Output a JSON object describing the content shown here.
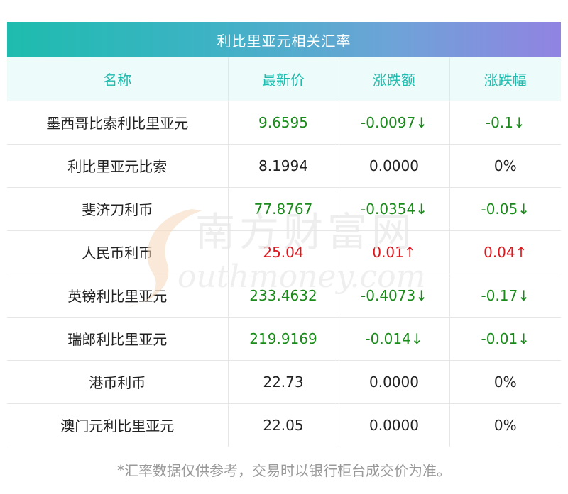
{
  "title": "利比里亚元相关汇率",
  "headers": {
    "name": "名称",
    "latest": "最新价",
    "change": "涨跌额",
    "change_pct": "涨跌幅"
  },
  "rows": [
    {
      "name": "墨西哥比索利比里亚元",
      "latest": "9.6595",
      "change": "-0.0097↓",
      "change_pct": "-0.1↓",
      "dir": "down"
    },
    {
      "name": "利比里亚元比索",
      "latest": "8.1994",
      "change": "0.0000",
      "change_pct": "0%",
      "dir": "flat"
    },
    {
      "name": "斐济刀利币",
      "latest": "77.8767",
      "change": "-0.0354↓",
      "change_pct": "-0.05↓",
      "dir": "down"
    },
    {
      "name": "人民币利币",
      "latest": "25.04",
      "change": "0.01↑",
      "change_pct": "0.04↑",
      "dir": "up"
    },
    {
      "name": "英镑利比里亚元",
      "latest": "233.4632",
      "change": "-0.4073↓",
      "change_pct": "-0.17↓",
      "dir": "down"
    },
    {
      "name": "瑞郎利比里亚元",
      "latest": "219.9169",
      "change": "-0.014↓",
      "change_pct": "-0.01↓",
      "dir": "down"
    },
    {
      "name": "港币利币",
      "latest": "22.73",
      "change": "0.0000",
      "change_pct": "0%",
      "dir": "flat"
    },
    {
      "name": "澳门元利比里亚元",
      "latest": "22.05",
      "change": "0.0000",
      "change_pct": "0%",
      "dir": "flat"
    }
  ],
  "footer": "*汇率数据仅供参考，交易时以银行柜台成交价为准。",
  "watermark": {
    "cn": "南方财富网",
    "en": "outhmoney.com"
  },
  "colors": {
    "gradient_start": "#1ebcae",
    "gradient_end": "#9183e2",
    "header_text": "#1ebcae",
    "header_bg": "#eefbfb",
    "down": "#1a8a1a",
    "up": "#e0161c"
  }
}
